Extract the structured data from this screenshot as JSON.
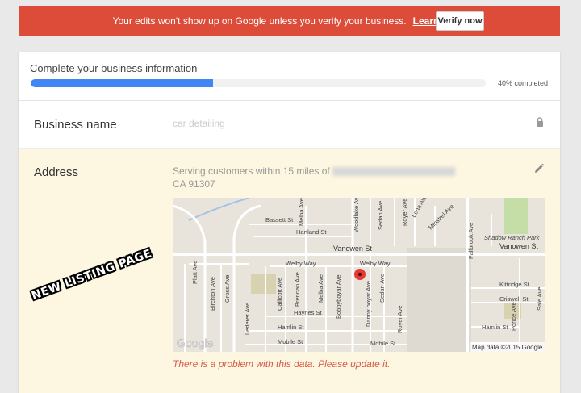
{
  "banner": {
    "message": "Your edits won't show up on Google unless you verify your business.",
    "link": "Learn more",
    "button": "Verify now",
    "bg_color": "#dd4b39"
  },
  "progress": {
    "title": "Complete your business information",
    "percent_completed": 40,
    "label": "40% completed",
    "bar_color": "#4285f4"
  },
  "business_name": {
    "label": "Business name",
    "value": "car detailing",
    "icon": "lock-icon"
  },
  "address": {
    "label": "Address",
    "line1": "Serving customers within 15 miles of",
    "line2": "CA 91307",
    "icon": "pencil-icon",
    "problem": "There is a problem with this data. Please update it."
  },
  "map": {
    "streets": [
      "Bassett St",
      "Hartland St",
      "Vanowen St",
      "Welby Way",
      "Welby Way",
      "Haynes St",
      "Hamlin St",
      "Mobile St",
      "Mobile St",
      "Hamlin St",
      "Kittridge St",
      "Criswell St",
      "Vanowen St",
      "Fallbrook Ave",
      "Platt Ave",
      "Birchton Ave",
      "Gross Ave",
      "Lederer Ave",
      "Callicott Ave",
      "Brennan Ave",
      "Melba Ave",
      "Melba Ave",
      "Bobbyboyar Ave",
      "Woodlake Ave",
      "Sedan Ave",
      "Sedan Ave",
      "Royer Ave",
      "Royer Ave",
      "Lena Ave",
      "Minstrel Ave",
      "Danny boyar Ave",
      "Ponce Ave",
      "Sale Ave"
    ],
    "park": "Shadow Ranch Park",
    "logo": "Google",
    "attribution": "Map data ©2015 Google"
  },
  "stamp": "NEW LISTING PAGE"
}
